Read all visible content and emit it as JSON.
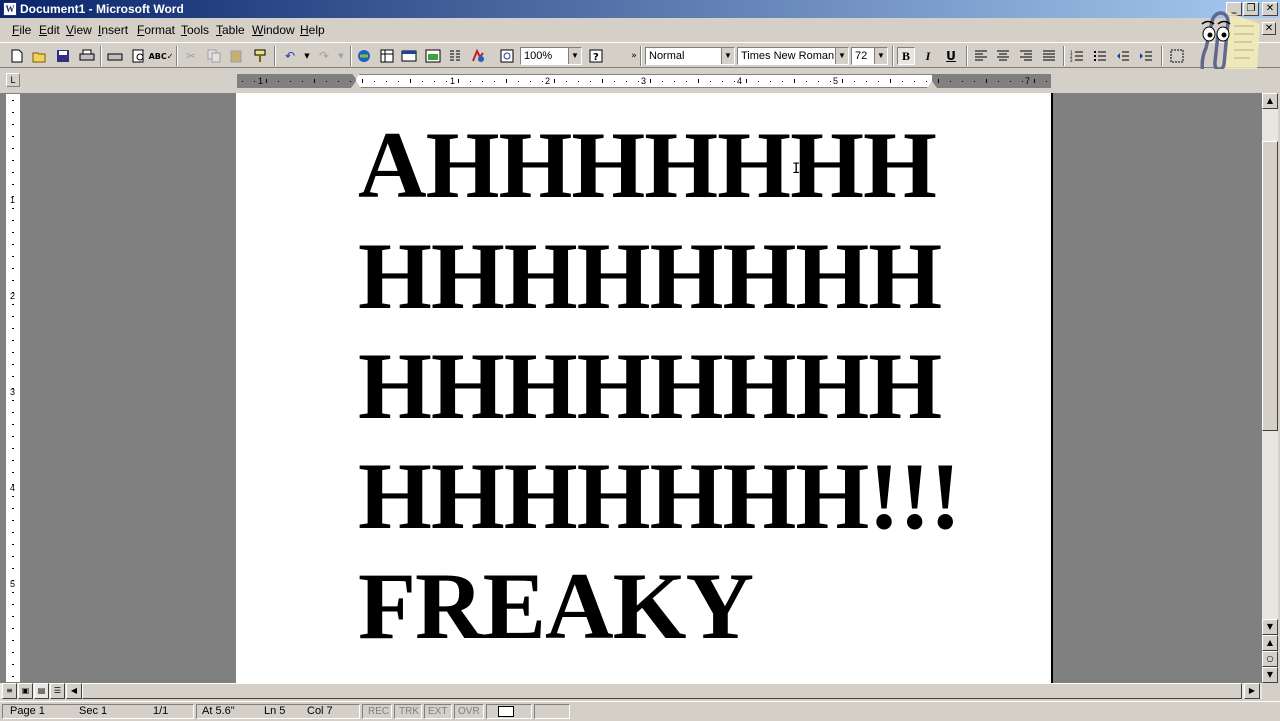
{
  "window": {
    "title": "Document1 - Microsoft Word",
    "app_icon_letter": "W",
    "controls": {
      "minimize": "_",
      "restore": "❐",
      "close": "✕"
    },
    "doc_close": "✕"
  },
  "menu": [
    "File",
    "Edit",
    "View",
    "Insert",
    "Format",
    "Tools",
    "Table",
    "Window",
    "Help"
  ],
  "toolbar": {
    "zoom": "100%",
    "style": "Normal",
    "font": "Times New Roman",
    "font_size": "72",
    "bold_label": "B",
    "italic_label": "I",
    "underline_label": "U",
    "icons": [
      "new-icon",
      "open-icon",
      "save-icon",
      "print-icon",
      "print-preview-icon",
      "spelling-icon",
      "cut-icon",
      "copy-icon",
      "paste-icon",
      "format-painter-icon",
      "undo-icon",
      "redo-icon",
      "hyperlink-icon",
      "tables-borders-icon",
      "insert-table-icon",
      "insert-excel-icon",
      "columns-icon",
      "drawing-icon",
      "document-map-icon",
      "help-icon"
    ]
  },
  "ruler": {
    "numbers": [
      "1",
      "1",
      "2",
      "3",
      "4",
      "5",
      "7"
    ],
    "corner": "L"
  },
  "vruler_numbers": [
    "1",
    "2",
    "3",
    "4",
    "5"
  ],
  "document": {
    "lines": [
      "AHHHHHHH",
      "HHHHHHHH",
      "HHHHHHHH",
      "HHHHHHH!!!",
      "FREAKY"
    ]
  },
  "status": {
    "page": "Page 1",
    "sec": "Sec 1",
    "pages": "1/1",
    "at": "At 5.6\"",
    "ln": "Ln 5",
    "col": "Col 7",
    "rec": "REC",
    "trk": "TRK",
    "ext": "EXT",
    "ovr": "OVR"
  }
}
